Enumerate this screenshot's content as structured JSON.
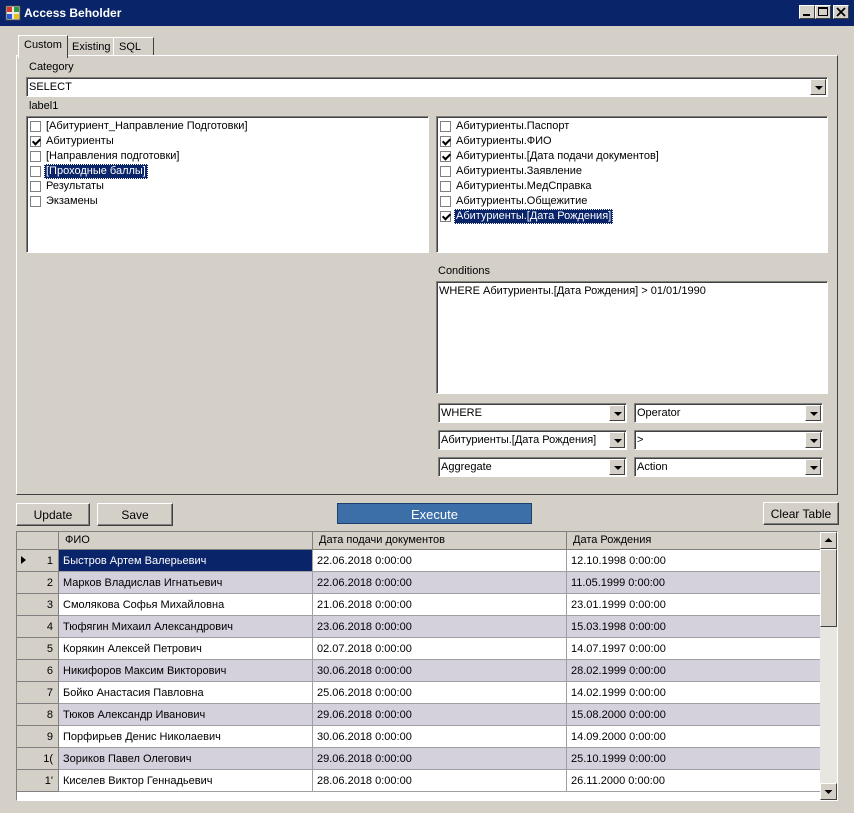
{
  "window": {
    "title": "Access Beholder"
  },
  "tabs": [
    {
      "label": "Custom"
    },
    {
      "label": "Existing"
    },
    {
      "label": "SQL"
    }
  ],
  "category": {
    "label": "Category",
    "value": "SELECT"
  },
  "tables_list": {
    "label": "label1",
    "items": [
      {
        "text": "[Абитуриент_Направление Подготовки]",
        "checked": false,
        "selected": false
      },
      {
        "text": "Абитуриенты",
        "checked": true,
        "selected": false
      },
      {
        "text": "[Направления подготовки]",
        "checked": false,
        "selected": false
      },
      {
        "text": "[Проходные баллы]",
        "checked": false,
        "selected": true
      },
      {
        "text": "Результаты",
        "checked": false,
        "selected": false
      },
      {
        "text": "Экзамены",
        "checked": false,
        "selected": false
      }
    ]
  },
  "fields_list": {
    "items": [
      {
        "text": "Абитуриенты.Паспорт",
        "checked": false,
        "selected": false
      },
      {
        "text": "Абитуриенты.ФИО",
        "checked": true,
        "selected": false
      },
      {
        "text": "Абитуриенты.[Дата подачи документов]",
        "checked": true,
        "selected": false
      },
      {
        "text": "Абитуриенты.Заявление",
        "checked": false,
        "selected": false
      },
      {
        "text": "Абитуриенты.МедСправка",
        "checked": false,
        "selected": false
      },
      {
        "text": "Абитуриенты.Общежитие",
        "checked": false,
        "selected": false
      },
      {
        "text": "Абитуриенты.[Дата Рождения]",
        "checked": true,
        "selected": true
      }
    ]
  },
  "conditions": {
    "label": "Conditions",
    "text": "WHERE Абитуриенты.[Дата Рождения] > 01/01/1990"
  },
  "selectors": {
    "clause": "WHERE",
    "operator": "Operator",
    "field": "Абитуриенты.[Дата Рождения]",
    "comparison": ">",
    "aggregate": "Aggregate",
    "action": "Action"
  },
  "buttons": {
    "update": "Update",
    "save": "Save",
    "execute": "Execute",
    "clear": "Clear Table"
  },
  "grid": {
    "columns": [
      "ФИО",
      "Дата подачи документов",
      "Дата Рождения"
    ],
    "rows": [
      {
        "num": "1",
        "cells": [
          "Быстров Артем Валерьевич",
          "22.06.2018 0:00:00",
          "12.10.1998 0:00:00"
        ]
      },
      {
        "num": "2",
        "cells": [
          "Марков Владислав Игнатьевич",
          "22.06.2018 0:00:00",
          "11.05.1999 0:00:00"
        ]
      },
      {
        "num": "3",
        "cells": [
          "Смолякова Софья Михайловна",
          "21.06.2018 0:00:00",
          "23.01.1999 0:00:00"
        ]
      },
      {
        "num": "4",
        "cells": [
          "Тюфягин Михаил Александрович",
          "23.06.2018 0:00:00",
          "15.03.1998 0:00:00"
        ]
      },
      {
        "num": "5",
        "cells": [
          "Корякин Алексей Петрович",
          "02.07.2018 0:00:00",
          "14.07.1997 0:00:00"
        ]
      },
      {
        "num": "6",
        "cells": [
          "Никифоров Максим Викторович",
          "30.06.2018 0:00:00",
          "28.02.1999 0:00:00"
        ]
      },
      {
        "num": "7",
        "cells": [
          "Бойко Анастасия Павловна",
          "25.06.2018 0:00:00",
          "14.02.1999 0:00:00"
        ]
      },
      {
        "num": "8",
        "cells": [
          "Тюков Александр Иванович",
          "29.06.2018 0:00:00",
          "15.08.2000 0:00:00"
        ]
      },
      {
        "num": "9",
        "cells": [
          "Порфирьев Денис Николаевич",
          "30.06.2018 0:00:00",
          "14.09.2000 0:00:00"
        ]
      },
      {
        "num": "1(",
        "cells": [
          "Зориков Павел Олегович",
          "29.06.2018 0:00:00",
          "25.10.1999 0:00:00"
        ]
      },
      {
        "num": "1'",
        "cells": [
          "Киселев Виктор Геннадьевич",
          "28.06.2018 0:00:00",
          "26.11.2000 0:00:00"
        ]
      }
    ]
  },
  "colors": {
    "titlebar": "#0a246a",
    "selection": "#0a246a",
    "execute": "#3c6ea8",
    "face": "#d4d0c8"
  }
}
